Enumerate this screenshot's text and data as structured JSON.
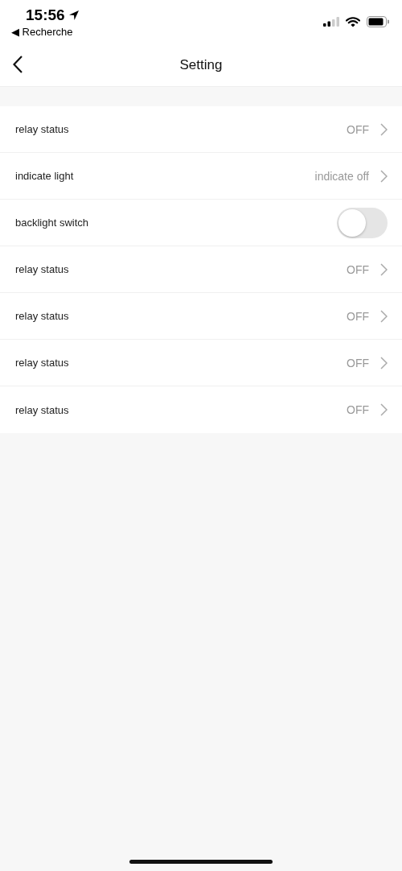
{
  "status_bar": {
    "time": "15:56",
    "back_app": "◀ Recherche"
  },
  "nav": {
    "title": "Setting"
  },
  "rows": [
    {
      "kind": "value",
      "label": "relay status",
      "value": "OFF"
    },
    {
      "kind": "value",
      "label": "indicate light",
      "value": "indicate off"
    },
    {
      "kind": "switch",
      "label": "backlight switch",
      "on": false
    },
    {
      "kind": "value",
      "label": "relay status",
      "value": "OFF"
    },
    {
      "kind": "value",
      "label": "relay status",
      "value": "OFF"
    },
    {
      "kind": "value",
      "label": "relay status",
      "value": "OFF"
    },
    {
      "kind": "value",
      "label": "relay status",
      "value": "OFF"
    }
  ]
}
